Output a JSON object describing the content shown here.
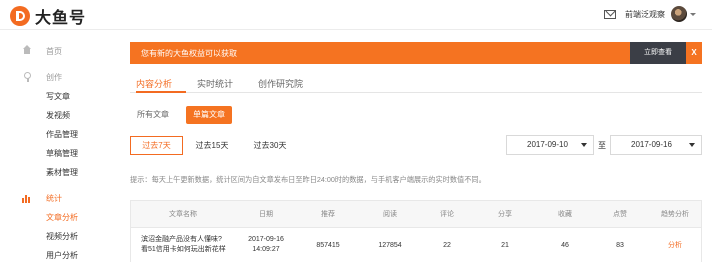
{
  "header": {
    "logo_text": "大鱼号",
    "user_name": "前端泛观察",
    "icons": [
      "logo-icon",
      "mail-icon",
      "avatar",
      "caret-down-icon"
    ]
  },
  "sidebar": {
    "home": "首页",
    "create_section": "创作",
    "create_items": [
      "写文章",
      "发视频",
      "作品管理",
      "草稿管理",
      "素材管理"
    ],
    "stats_section": "统计",
    "stats_items": [
      "文章分析",
      "视频分析",
      "用户分析"
    ],
    "active_item": "文章分析"
  },
  "banner": {
    "text": "您有新的大鱼权益可以获取",
    "button": "立即查看",
    "close": "X"
  },
  "tabs": {
    "items": [
      "内容分析",
      "实时统计",
      "创作研究院"
    ],
    "active": "内容分析"
  },
  "subtabs": {
    "items": [
      "所有文章",
      "单篇文章"
    ],
    "active": "单篇文章"
  },
  "date_ranges": {
    "items": [
      "过去7天",
      "过去15天",
      "过去30天"
    ],
    "active": "过去7天",
    "start_date": "2017-09-10",
    "separator": "至",
    "end_date": "2017-09-16"
  },
  "hint": "提示：每天上午更新数据，统计区间为自文章发布日至昨日24:00时的数据，与手机客户端展示的实时数值不同。",
  "table": {
    "headers": [
      "文章名称",
      "日期",
      "推荐",
      "阅读",
      "评论",
      "分享",
      "收藏",
      "点赞",
      "趋势分析"
    ],
    "rows": [
      {
        "title_line1": "滨沼金融产品没有人懂味?",
        "title_line2": "看51信用卡如何玩出新花样",
        "date_line1": "2017-09-16",
        "date_line2": "14:09:27",
        "recommend": "857415",
        "read": "127854",
        "comment": "22",
        "share": "21",
        "favorite": "46",
        "like": "83",
        "action": "分析"
      }
    ]
  },
  "colors": {
    "accent": "#f36b21",
    "banner_bg": "#f57321",
    "banner_button_bg": "#3b3e46"
  }
}
